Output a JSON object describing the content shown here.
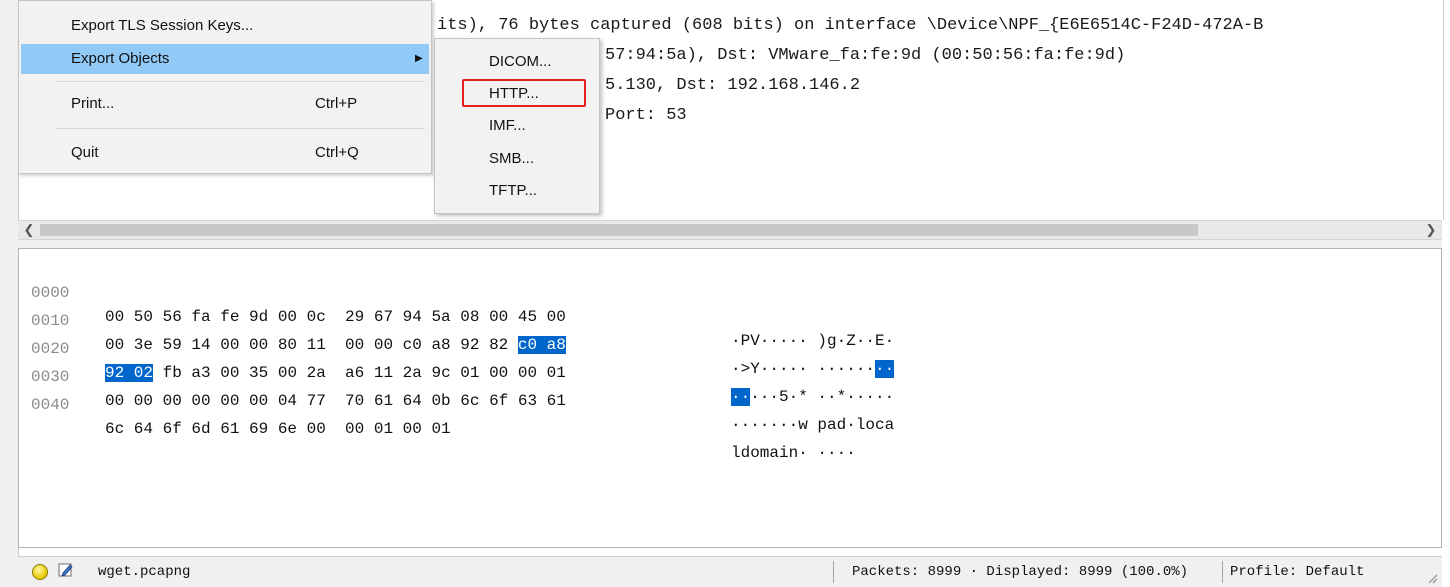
{
  "detail_lines": [
    "its), 76 bytes captured (608 bits) on interface \\Device\\NPF_{E6E6514C-F24D-472A-B",
    "57:94:5a), Dst: VMware_fa:fe:9d (00:50:56:fa:fe:9d)",
    "5.130, Dst: 192.168.146.2",
    "Port: 53"
  ],
  "file_menu": {
    "items": [
      {
        "label": "Export TLS Session Keys...",
        "shortcut": ""
      },
      {
        "label": "Export Objects",
        "shortcut": "",
        "has_submenu": true
      },
      {
        "label": "Print...",
        "shortcut": "Ctrl+P"
      },
      {
        "label": "Quit",
        "shortcut": "Ctrl+Q"
      }
    ]
  },
  "submenu": {
    "items": [
      {
        "label": "DICOM..."
      },
      {
        "label": "HTTP...",
        "highlighted_by_annotation": true
      },
      {
        "label": "IMF..."
      },
      {
        "label": "SMB..."
      },
      {
        "label": "TFTP..."
      }
    ]
  },
  "hex": {
    "rows": [
      {
        "offset": "0000",
        "bytes_plain_a": "00 50 56 fa fe 9d 00 0c  29 67 94 5a 08 00 45 00",
        "bytes_hl": "",
        "bytes_plain_b": "",
        "ascii_hl_a": "",
        "ascii": "·PV····· )g·Z··E·",
        "ascii_hl_b": ""
      },
      {
        "offset": "0010",
        "bytes_plain_a": "00 3e 59 14 00 00 80 11  00 00 c0 a8 92 82 ",
        "bytes_hl": "c0 a8",
        "bytes_plain_b": "",
        "ascii_hl_a": "",
        "ascii": "·>Y····· ······",
        "ascii_hl_b": "··"
      },
      {
        "offset": "0020",
        "bytes_plain_a": "",
        "bytes_hl": "92 02",
        "bytes_plain_b": " fb a3 00 35 00 2a  a6 11 2a 9c 01 00 00 01",
        "ascii_hl_a": "··",
        "ascii": "···5·* ··*·····",
        "ascii_hl_b": ""
      },
      {
        "offset": "0030",
        "bytes_plain_a": "00 00 00 00 00 00 04 77  70 61 64 0b 6c 6f 63 61",
        "bytes_hl": "",
        "bytes_plain_b": "",
        "ascii_hl_a": "",
        "ascii": "·······w pad·loca",
        "ascii_hl_b": ""
      },
      {
        "offset": "0040",
        "bytes_plain_a": "6c 64 6f 6d 61 69 6e 00  00 01 00 01",
        "bytes_hl": "",
        "bytes_plain_b": "",
        "ascii_hl_a": "",
        "ascii": "ldomain· ····",
        "ascii_hl_b": ""
      }
    ]
  },
  "status": {
    "file": "wget.pcapng",
    "counts": "Packets: 8999 · Displayed: 8999 (100.0%)",
    "profile": "Profile: Default"
  },
  "colors": {
    "menu_active": "#91c9f7",
    "byte_highlight": "#0066cc",
    "annotation_box": "#e3201b"
  }
}
